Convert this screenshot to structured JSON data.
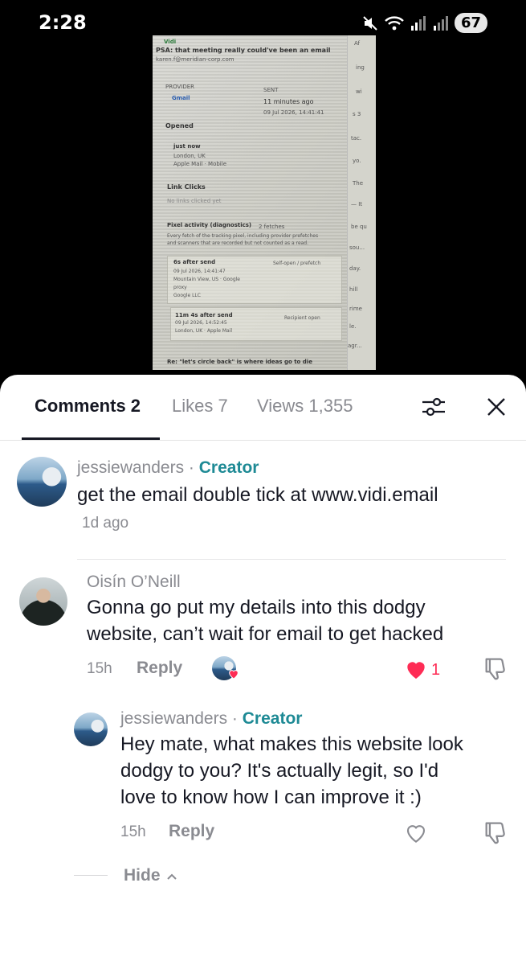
{
  "status_bar": {
    "time": "2:28",
    "battery": "67",
    "icons": [
      "mute-icon",
      "wifi-icon",
      "signal-icon",
      "signal-icon"
    ]
  },
  "email_screenshot": {
    "app": "Vidi",
    "subject": "PSA: that meeting really could've been an email",
    "to": "karen.f@meridian-corp.com",
    "provider_label": "PROVIDER",
    "provider": "Gmail",
    "sent_label": "SENT",
    "sent_relative": "11 minutes ago",
    "sent_date": "09 Jul 2026, 14:41:41",
    "opened_label": "Opened",
    "opened_time": "just now",
    "opened_location": "London, UK",
    "opened_client": "Apple Mail · Mobile",
    "link_clicks_label": "Link Clicks",
    "link_clicks_value": "No links clicked yet",
    "pixel_title": "Pixel activity (diagnostics)",
    "pixel_count": "2 fetches",
    "pixel_desc_1": "Every fetch of the tracking pixel, including provider prefetches",
    "pixel_desc_2": "and scanners that are recorded but not counted as a read.",
    "fetch1_title": "6s after send",
    "fetch1_tag": "Self-open / prefetch",
    "fetch1_date": "09 Jul 2026, 14:41:47",
    "fetch1_loc": "Mountain View, US · Google",
    "fetch1_loc2": "proxy",
    "fetch1_org": "Google LLC",
    "fetch2_title": "11m 4s after send",
    "fetch2_tag": "Recipient open",
    "fetch2_date": "09 Jul 2026, 14:52:45",
    "fetch2_loc": "London, UK · Apple Mail",
    "footer_line": "Re: \"let's circle back\" is where ideas go to die",
    "side_fragments": [
      "Af",
      "ing",
      "wi",
      "s 3",
      "tac.",
      "yo.",
      "The",
      "— It",
      "be qu",
      "sou...",
      "day.",
      "hill",
      "rime",
      "le.",
      "agr..."
    ]
  },
  "tabs": {
    "comments": "Comments 2",
    "likes": "Likes 7",
    "views": "Views 1,355"
  },
  "comments": [
    {
      "username": "jessiewanders",
      "separator": " · ",
      "badge": "Creator",
      "text": "get the email double tick at www.vidi.email",
      "time": "1d ago"
    },
    {
      "username": "Oisín O’Neill",
      "text_line1": "Gonna go put my details into this dodgy",
      "text_line2": "website, can’t wait for email to get hacked",
      "time": "15h",
      "reply": "Reply",
      "likes": "1"
    },
    {
      "username": "jessiewanders",
      "separator": " · ",
      "badge": "Creator",
      "text_line1": "Hey mate, what makes this website look",
      "text_line2": "dodgy to you? It's actually legit, so I'd",
      "text_line3": "love to know how I can improve it :)",
      "time": "15h",
      "reply": "Reply"
    }
  ],
  "hide_replies": "Hide",
  "colors": {
    "creator": "#1e8a95",
    "like": "#fe2c55",
    "muted": "#8a8b91",
    "text": "#161823"
  }
}
